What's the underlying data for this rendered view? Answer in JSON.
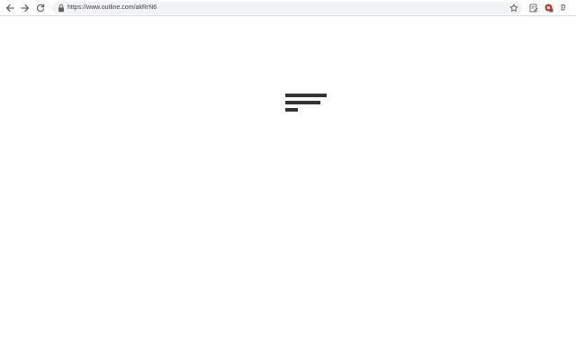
{
  "browser": {
    "url": "https://www.outline.com/akRrN6",
    "icons": {
      "back": "arrow-left-icon",
      "forward": "arrow-right-icon",
      "reload": "reload-icon",
      "lock": "lock-icon",
      "bookmark": "star-icon",
      "extension_1": "edit-note-icon",
      "extension_2": "red-badge-icon",
      "extension_3": "puzzle-icon"
    },
    "colors": {
      "omnibox_bg": "#f1f3f4",
      "toolbar_border": "#d9d9d9",
      "loader_bar": "#333333"
    }
  },
  "page": {
    "loader_icon": "outline-loading-lines-icon"
  }
}
